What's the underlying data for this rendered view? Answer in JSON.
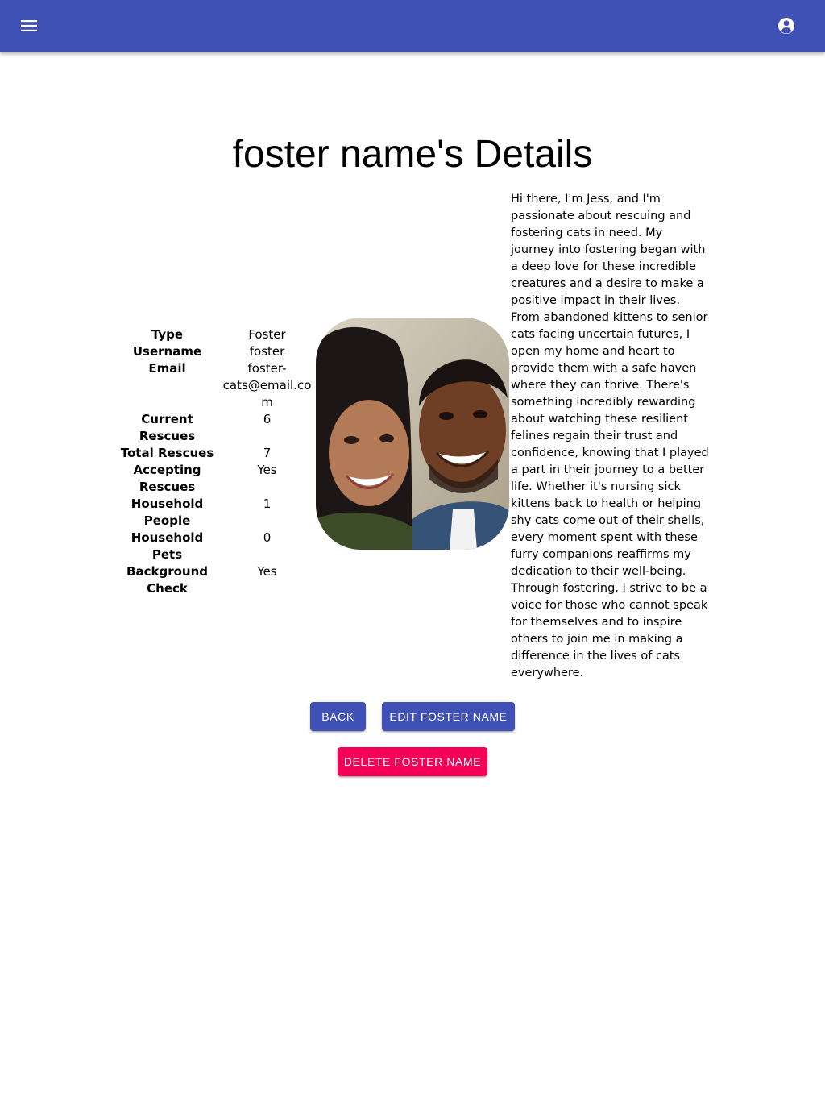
{
  "appbar": {
    "color": "#3f51b5",
    "menu_icon": "menu-icon",
    "account_icon": "account-circle-icon"
  },
  "page": {
    "title": "foster name's Details"
  },
  "details": [
    {
      "label": "Type",
      "value": "Foster"
    },
    {
      "label": "Username",
      "value": "foster"
    },
    {
      "label": "Email",
      "value": "foster-cats@email.com"
    },
    {
      "label": "Current Rescues",
      "value": "6"
    },
    {
      "label": "Total Rescues",
      "value": "7"
    },
    {
      "label": "Accepting Rescues",
      "value": "Yes"
    },
    {
      "label": "Household People",
      "value": "1"
    },
    {
      "label": "Household Pets",
      "value": "0"
    },
    {
      "label": "Background Check",
      "value": "Yes"
    }
  ],
  "bio": "Hi there, I'm Jess, and I'm passionate about rescuing and fostering cats in need. My journey into fostering began with a deep love for these incredible creatures and a desire to make a positive impact in their lives. From abandoned kittens to senior cats facing uncertain futures, I open my home and heart to provide them with a safe haven where they can thrive. There's something incredibly rewarding about watching these resilient felines regain their trust and confidence, knowing that I played a part in their journey to a better life. Whether it's nursing sick kittens back to health or helping shy cats come out of their shells, every moment spent with these furry companions reaffirms my dedication to their well-being. Through fostering, I strive to be a voice for those who cannot speak for themselves and to inspire others to join me in making a difference in the lives of cats everywhere.",
  "buttons": {
    "back": "BACK",
    "edit": "EDIT FOSTER NAME",
    "delete": "DELETE FOSTER NAME",
    "primary_color": "#3f51b5",
    "accent_color": "#f50057"
  }
}
